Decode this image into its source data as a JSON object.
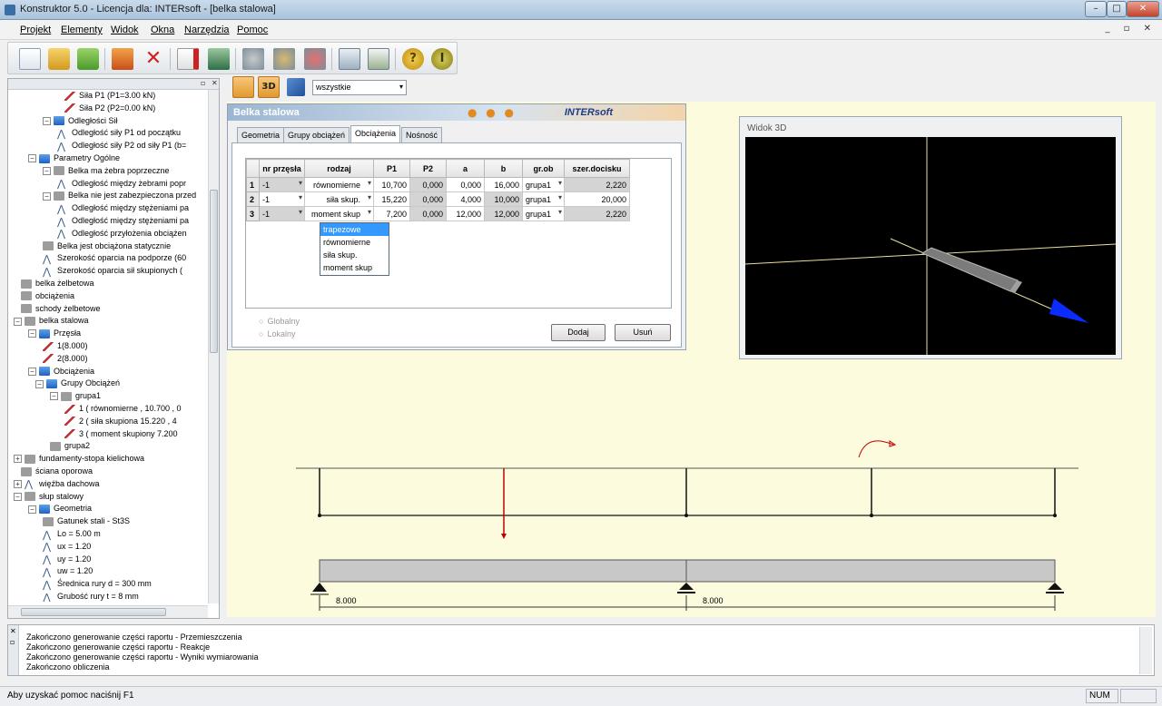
{
  "window": {
    "title": "Konstruktor 5.0 - Licencja dla: INTERsoft - [belka stalowa]",
    "min": "–",
    "max": "□",
    "close": "✕"
  },
  "menu": [
    "Projekt",
    "Elementy",
    "Widok",
    "Okna",
    "Narzędzia",
    "Pomoc"
  ],
  "mdi_controls": "_ ▫ ✕",
  "toolbar_icons": [
    "new-file-icon",
    "open-folder-icon",
    "open-icon",
    "save-icon",
    "delete-icon",
    "pdf-report-icon",
    "export-icon",
    "calc-settings-icon",
    "calc-tools-icon",
    "calc-remove-icon",
    "calculator-icon",
    "print-icon",
    "help-icon",
    "info-icon"
  ],
  "view_toolbar": {
    "filter_value": "wszystkie",
    "btn_2d": "2D",
    "btn_3d": "3D"
  },
  "tree": [
    {
      "label": "Siła P1 (P1=3.00 kN)",
      "indent": 7,
      "icon": "line"
    },
    {
      "label": "Siła P2 (P2=0.00 kN)",
      "indent": 7,
      "icon": "line"
    },
    {
      "label": "Odległości Sił",
      "indent": 4,
      "icon": "folder",
      "ex": "−"
    },
    {
      "label": "Odległość siły P1 od początku",
      "indent": 6,
      "icon": "a"
    },
    {
      "label": "Odległość siły P2 od siły P1 (b=",
      "indent": 6,
      "icon": "a"
    },
    {
      "label": "Parametry Ogólne",
      "indent": 2,
      "icon": "folder",
      "ex": "−"
    },
    {
      "label": "Belka ma żebra poprzeczne",
      "indent": 4,
      "icon": "gray",
      "ex": "−"
    },
    {
      "label": "Odległość między żebrami popr",
      "indent": 6,
      "icon": "a"
    },
    {
      "label": "Belka nie jest zabezpieczona przed",
      "indent": 4,
      "icon": "gray",
      "ex": "−"
    },
    {
      "label": "Odległość między stężeniami pa",
      "indent": 6,
      "icon": "a"
    },
    {
      "label": "Odległość między stężeniami pa",
      "indent": 6,
      "icon": "a"
    },
    {
      "label": "Odległość przyłożenia obciążen",
      "indent": 6,
      "icon": "a"
    },
    {
      "label": "Belka jest obciążona statycznie",
      "indent": 4,
      "icon": "gray"
    },
    {
      "label": "Szerokość oparcia na podporze (60",
      "indent": 4,
      "icon": "a"
    },
    {
      "label": "Szerokość oparcia sił skupionych (",
      "indent": 4,
      "icon": "a"
    },
    {
      "label": "belka żelbetowa",
      "indent": 1,
      "icon": "gray"
    },
    {
      "label": "obciążenia",
      "indent": 1,
      "icon": "gray"
    },
    {
      "label": "schody żelbetowe",
      "indent": 1,
      "icon": "gray"
    },
    {
      "label": "belka stalowa",
      "indent": 0,
      "icon": "gray",
      "ex": "−"
    },
    {
      "label": "Przęsła",
      "indent": 2,
      "icon": "folder",
      "ex": "−"
    },
    {
      "label": "1(8.000)",
      "indent": 4,
      "icon": "line"
    },
    {
      "label": "2(8.000)",
      "indent": 4,
      "icon": "line"
    },
    {
      "label": "Obciążenia",
      "indent": 2,
      "icon": "folder",
      "ex": "−"
    },
    {
      "label": "Grupy Obciążeń",
      "indent": 3,
      "icon": "folder",
      "ex": "−"
    },
    {
      "label": "grupa1",
      "indent": 5,
      "icon": "gray",
      "ex": "−"
    },
    {
      "label": "1 ( równomierne , 10.700 , 0",
      "indent": 7,
      "icon": "line"
    },
    {
      "label": "2 ( siła skupiona  15.220 , 4",
      "indent": 7,
      "icon": "line"
    },
    {
      "label": "3 ( moment skupiony  7.200",
      "indent": 7,
      "icon": "line"
    },
    {
      "label": "grupa2",
      "indent": 5,
      "icon": "gray"
    },
    {
      "label": "fundamenty-stopa kielichowa",
      "indent": 0,
      "icon": "gray",
      "ex": "+"
    },
    {
      "label": "ściana oporowa",
      "indent": 1,
      "icon": "gray"
    },
    {
      "label": "więźba dachowa",
      "indent": 0,
      "icon": "a",
      "ex": "+"
    },
    {
      "label": "słup stalowy",
      "indent": 0,
      "icon": "gray",
      "ex": "−"
    },
    {
      "label": "Geometria",
      "indent": 2,
      "icon": "folder",
      "ex": "−"
    },
    {
      "label": "Gatunek stali - St3S",
      "indent": 4,
      "icon": "gray"
    },
    {
      "label": "Lo = 5.00 m",
      "indent": 4,
      "icon": "a"
    },
    {
      "label": "ux = 1.20",
      "indent": 4,
      "icon": "a"
    },
    {
      "label": "uy = 1.20",
      "indent": 4,
      "icon": "a"
    },
    {
      "label": "uw = 1.20",
      "indent": 4,
      "icon": "a"
    },
    {
      "label": "Średnica rury d = 300 mm",
      "indent": 4,
      "icon": "a"
    },
    {
      "label": "Grubość rury t = 8 mm",
      "indent": 4,
      "icon": "a"
    }
  ],
  "belka_panel": {
    "title": "Belka stalowa",
    "logo": "INTERsoft",
    "dots": "● ● ●",
    "tabs": [
      "Geometria",
      "Grupy obciążeń",
      "Obciążenia",
      "Nośność"
    ],
    "columns": [
      "",
      "nr przęsła",
      "rodzaj",
      "P1",
      "P2",
      "a",
      "b",
      "gr.ob",
      "szer.docisku"
    ],
    "rows": [
      [
        "1",
        "-1",
        "równomierne",
        "10,700",
        "0,000",
        "0,000",
        "16,000",
        "grupa1",
        "2,220"
      ],
      [
        "2",
        "-1",
        "siła skup.",
        "15,220",
        "0,000",
        "4,000",
        "10,000",
        "grupa1",
        "20,000"
      ],
      [
        "3",
        "-1",
        "moment skup",
        "7,200",
        "0,000",
        "12,000",
        "12,000",
        "grupa1",
        "2,220"
      ]
    ],
    "dropdown_options": [
      "trapezowe",
      "równomierne",
      "siła skup.",
      "moment skup"
    ],
    "radio_global": "Globalny",
    "radio_local": "Lokalny",
    "btn_add": "Dodaj",
    "btn_remove": "Usuń"
  },
  "view3d": {
    "title": "Widok 3D"
  },
  "beam": {
    "span1": "8.000",
    "span2": "8.000"
  },
  "log": [
    "Zakończono generowanie części raportu - Przemieszczenia",
    "Zakończono generowanie części raportu - Reakcje",
    "Zakończono generowanie części raportu - Wyniki wymiarowania",
    "Zakończono obliczenia"
  ],
  "status": {
    "help": "Aby uzyskać pomoc naciśnij F1",
    "num": "NUM"
  },
  "colors": {
    "accent": "#3399ff",
    "load": "#c00000",
    "title_grad": "#9cb6d2"
  }
}
